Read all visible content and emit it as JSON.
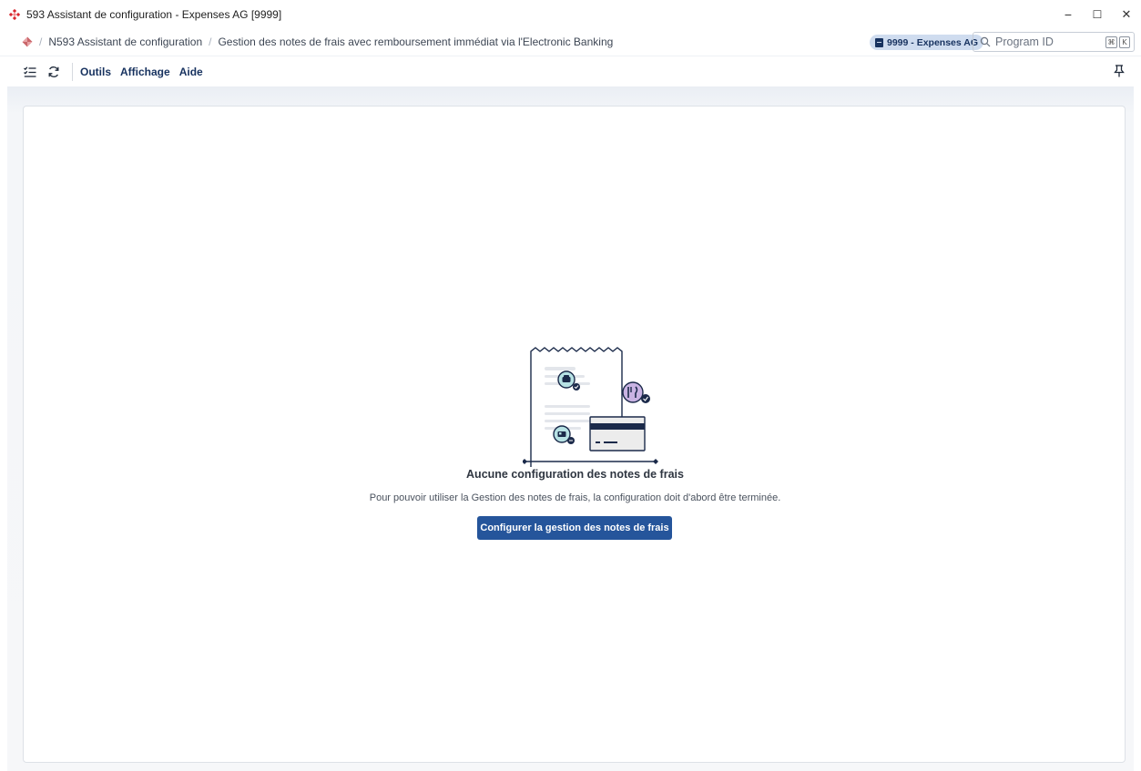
{
  "window": {
    "title": "593 Assistant de configuration - Expenses AG [9999]",
    "controls": {
      "minimize": "−",
      "maximize": "☐",
      "close": "✕"
    }
  },
  "breadcrumb": {
    "separator": "/",
    "items": [
      {
        "label": "N593 Assistant de configuration"
      },
      {
        "label": "Gestion des notes de frais avec remboursement immédiat via l'Electronic Banking"
      }
    ]
  },
  "tenant": {
    "label": "9999 - Expenses AG"
  },
  "search": {
    "placeholder": "Program ID",
    "shortcut_mod": "⌘",
    "shortcut_key": "K"
  },
  "toolbar": {
    "menus": [
      "Outils",
      "Affichage",
      "Aide"
    ]
  },
  "empty_state": {
    "title": "Aucune configuration des notes de frais",
    "description": "Pour pouvoir utiliser la Gestion des notes de frais, la configuration doit d'abord être terminée.",
    "button_label": "Configurer la gestion des notes de frais"
  },
  "colors": {
    "accent": "#25559b",
    "badge_bg": "#cfdcef",
    "navy": "#17325f",
    "brand_red": "#d9272e"
  }
}
